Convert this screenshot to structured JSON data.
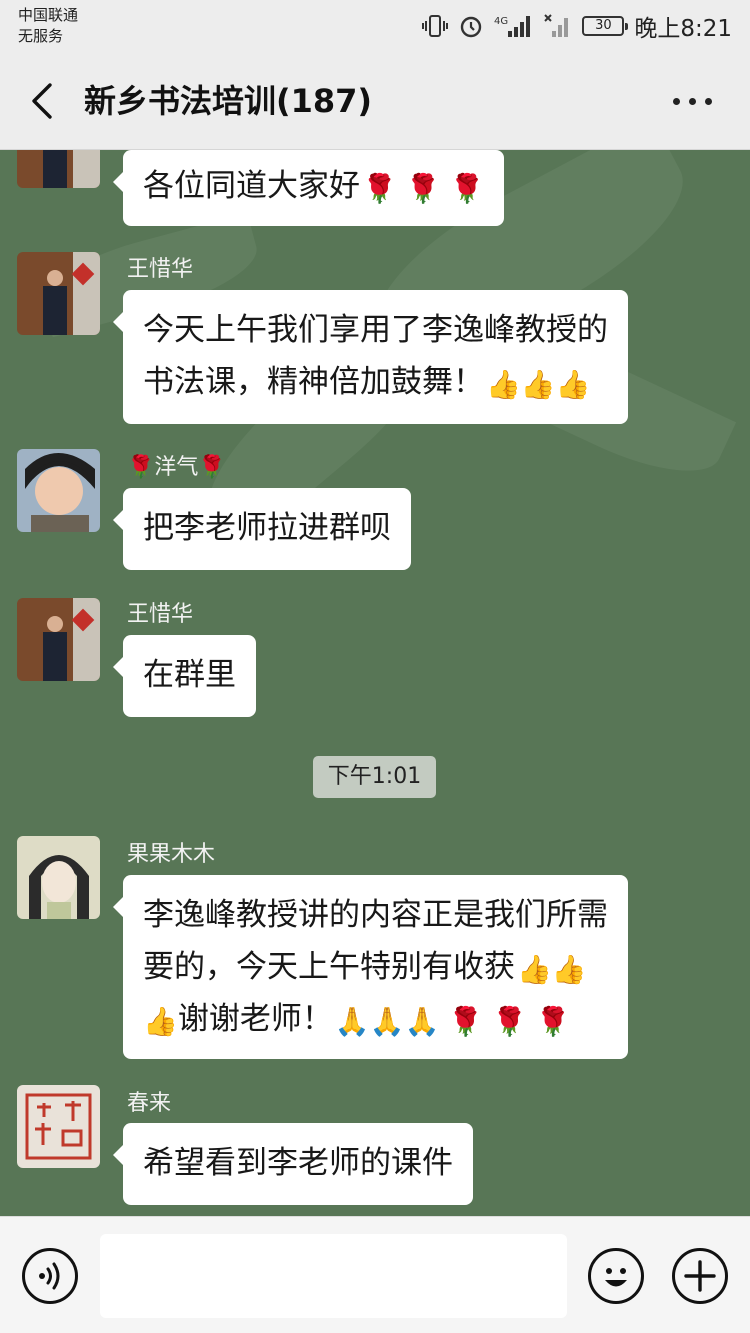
{
  "status_bar": {
    "carrier_line1": "中国联通",
    "carrier_line2": "无服务",
    "network": "4G",
    "battery": "30",
    "time": "晚上8:21",
    "icons": [
      "vibrate-icon",
      "alarm-icon",
      "signal-icon",
      "no-signal-icon",
      "battery-icon"
    ]
  },
  "header": {
    "title": "新乡书法培训(187)",
    "back_icon": "chevron-left-icon",
    "more_icon": "more-dots-icon"
  },
  "messages": [
    {
      "sender": "",
      "text": "各位同道大家好",
      "emoji": "🌹 🌹 🌹"
    },
    {
      "sender": "王惜华",
      "line1": "今天上午我们享用了李逸峰教授的",
      "line2": "书法课，精神倍加鼓舞！",
      "emoji": "👍👍👍"
    },
    {
      "sender_prefix": "🌹",
      "sender": "洋气",
      "sender_suffix": "🌹",
      "text": "把李老师拉进群呗"
    },
    {
      "sender": "王惜华",
      "text": "在群里"
    },
    {
      "sender": "果果木木",
      "line1": "李逸峰教授讲的内容正是我们所需",
      "line2": "要的，今天上午特别有收获",
      "line2_emoji": "👍👍",
      "line3_emoji_lead": "👍",
      "line3": "谢谢老师！",
      "line3_emoji": "🙏🙏🙏 🌹 🌹 🌹"
    },
    {
      "sender": "春来",
      "text": "希望看到李老师的课件"
    }
  ],
  "timestamp": "下午1:01",
  "input_bar": {
    "voice_icon": "voice-icon",
    "input_placeholder": "",
    "emoji_icon": "smiley-icon",
    "plus_icon": "plus-icon"
  },
  "colors": {
    "chat_background": "#587656",
    "bar_background": "#ededed",
    "bubble": "#ffffff"
  }
}
